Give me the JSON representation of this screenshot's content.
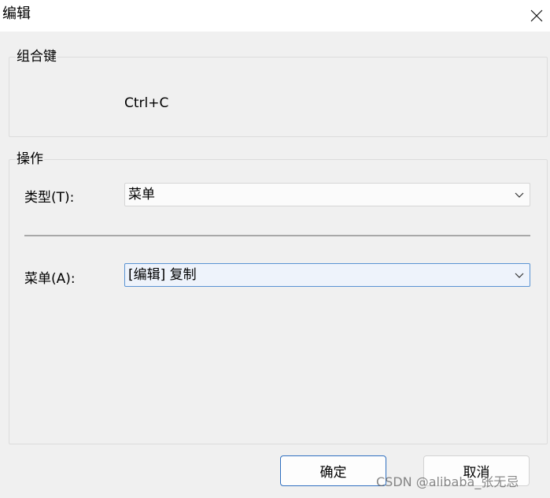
{
  "window": {
    "title": "编辑",
    "close_icon": "close-icon"
  },
  "hotkey_group": {
    "title": "组合键",
    "value": "Ctrl+C"
  },
  "action_group": {
    "title": "操作",
    "type_label": "类型(T):",
    "type_value": "菜单",
    "menu_label": "菜单(A):",
    "menu_value": "[编辑] 复制"
  },
  "buttons": {
    "ok": "确定",
    "cancel": "取消"
  },
  "watermark": "CSDN @alibaba_张无忌",
  "colors": {
    "primary_border": "#2f6fc0",
    "active_field_border": "#5a93d3",
    "active_field_background": "#eef3fb"
  }
}
